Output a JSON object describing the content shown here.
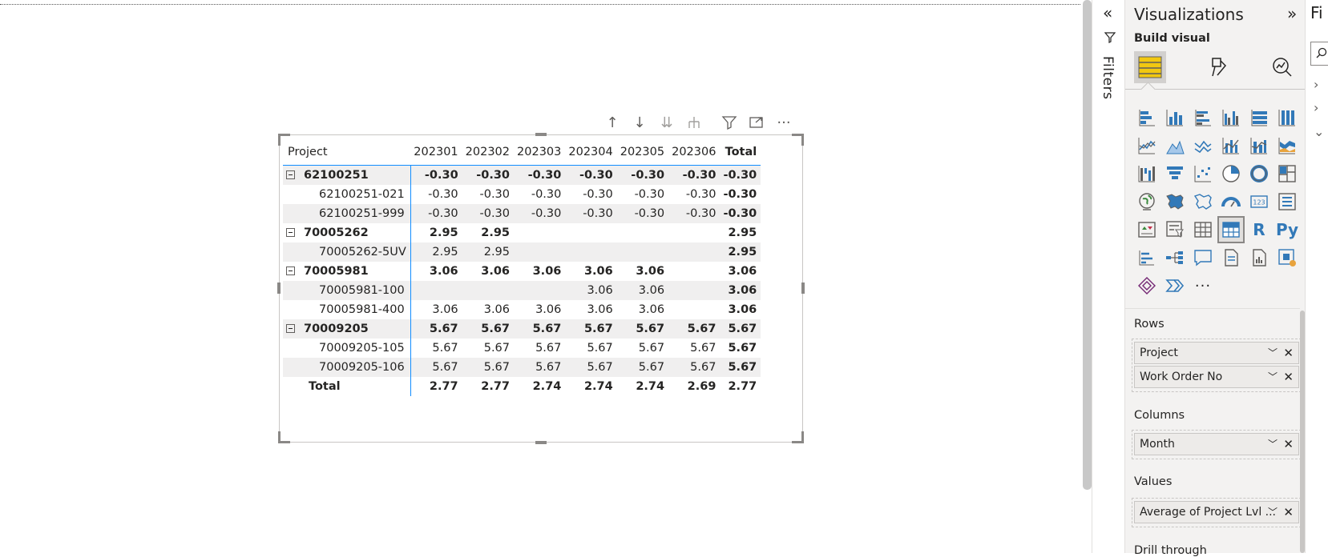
{
  "matrix": {
    "columns": [
      "Project",
      "202301",
      "202302",
      "202303",
      "202304",
      "202305",
      "202306",
      "Total"
    ],
    "rows": [
      {
        "type": "group",
        "label": "62100251",
        "values": [
          "-0.30",
          "-0.30",
          "-0.30",
          "-0.30",
          "-0.30",
          "-0.30",
          "-0.30"
        ]
      },
      {
        "type": "child",
        "label": "62100251-021",
        "values": [
          "-0.30",
          "-0.30",
          "-0.30",
          "-0.30",
          "-0.30",
          "-0.30",
          "-0.30"
        ]
      },
      {
        "type": "child",
        "label": "62100251-999",
        "values": [
          "-0.30",
          "-0.30",
          "-0.30",
          "-0.30",
          "-0.30",
          "-0.30",
          "-0.30"
        ]
      },
      {
        "type": "group",
        "label": "70005262",
        "values": [
          "2.95",
          "2.95",
          "",
          "",
          "",
          "",
          "2.95"
        ]
      },
      {
        "type": "child",
        "label": "70005262-5UV",
        "values": [
          "2.95",
          "2.95",
          "",
          "",
          "",
          "",
          "2.95"
        ]
      },
      {
        "type": "group",
        "label": "70005981",
        "values": [
          "3.06",
          "3.06",
          "3.06",
          "3.06",
          "3.06",
          "",
          "3.06"
        ]
      },
      {
        "type": "child",
        "label": "70005981-100",
        "values": [
          "",
          "",
          "",
          "3.06",
          "3.06",
          "",
          "3.06"
        ]
      },
      {
        "type": "child",
        "label": "70005981-400",
        "values": [
          "3.06",
          "3.06",
          "3.06",
          "3.06",
          "3.06",
          "",
          "3.06"
        ]
      },
      {
        "type": "group",
        "label": "70009205",
        "values": [
          "5.67",
          "5.67",
          "5.67",
          "5.67",
          "5.67",
          "5.67",
          "5.67"
        ]
      },
      {
        "type": "child",
        "label": "70009205-105",
        "values": [
          "5.67",
          "5.67",
          "5.67",
          "5.67",
          "5.67",
          "5.67",
          "5.67"
        ]
      },
      {
        "type": "child",
        "label": "70009205-106",
        "values": [
          "5.67",
          "5.67",
          "5.67",
          "5.67",
          "5.67",
          "5.67",
          "5.67"
        ]
      },
      {
        "type": "total",
        "label": "Total",
        "values": [
          "2.77",
          "2.77",
          "2.74",
          "2.74",
          "2.74",
          "2.69",
          "2.77"
        ]
      }
    ]
  },
  "header_icons": [
    "drill-up-icon",
    "drill-down-icon",
    "expand-all-icon",
    "expand-hierarchy-icon",
    "filter-icon",
    "focus-mode-icon",
    "more-options-icon"
  ],
  "filters_pane": {
    "label": "Filters"
  },
  "visualizations": {
    "title": "Visualizations",
    "build_label": "Build visual",
    "r_glyph": "R",
    "py_glyph": "Py",
    "more_glyph": "···",
    "rows_label": "Rows",
    "rows_fields": [
      "Project",
      "Work Order No"
    ],
    "columns_label": "Columns",
    "columns_fields": [
      "Month"
    ],
    "values_label": "Values",
    "values_fields": [
      "Average of Project Lvl ..."
    ],
    "drill_label": "Drill through"
  },
  "fields_pane": {
    "title": "Fi"
  },
  "colors": {
    "accent": "#118dff",
    "selected_icon": "#f2c811",
    "pane_bg": "#f3f2f1"
  }
}
